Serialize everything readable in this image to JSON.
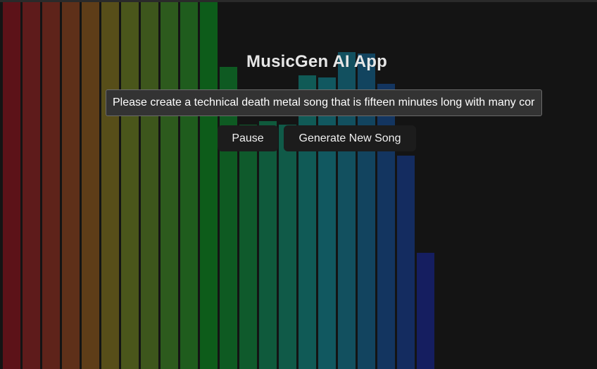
{
  "app": {
    "title": "MusicGen AI App"
  },
  "prompt": {
    "value": "Please create a technical death metal song that is fifteen minutes long with many cor"
  },
  "controls": {
    "pause_label": "Pause",
    "generate_label": "Generate New Song"
  },
  "visualizer": {
    "levels": [
      1.0,
      1.0,
      1.0,
      1.0,
      1.0,
      1.0,
      1.0,
      1.0,
      1.0,
      1.0,
      1.0,
      0.823,
      0.666,
      0.676,
      0.666,
      0.8,
      0.795,
      0.863,
      0.859,
      0.777,
      0.582,
      0.317
    ],
    "colors": [
      "#5c1218",
      "#5e1b1b",
      "#5e231a",
      "#5e3019",
      "#5e3d18",
      "#574e19",
      "#4a561b",
      "#3d561c",
      "#2d5a1d",
      "#1f5c1d",
      "#0d5c1a",
      "#0e5a22",
      "#0f5a2c",
      "#0f5a3c",
      "#105a48",
      "#105a56",
      "#115860",
      "#12505f",
      "#12445f",
      "#133560",
      "#142c60",
      "#151e60"
    ]
  }
}
